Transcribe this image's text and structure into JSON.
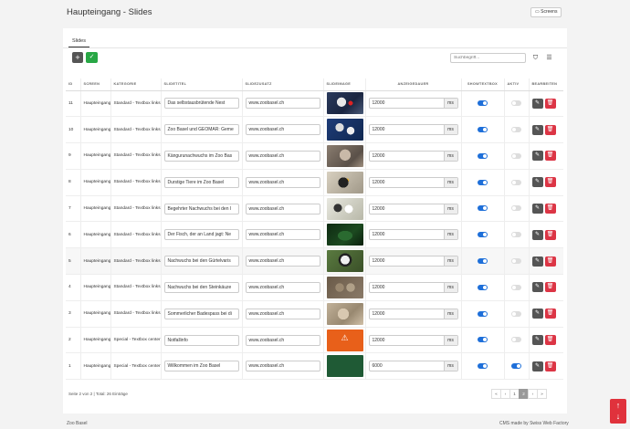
{
  "header": {
    "title": "Haupteingang - Slides",
    "screens_label": "Screens"
  },
  "tabs": [
    {
      "label": "Slides"
    }
  ],
  "toolbar": {
    "add_label": "+",
    "check_label": "✓",
    "search_placeholder": "Suchbegriff..."
  },
  "columns": [
    "ID",
    "SCREEN",
    "KATEGORIE",
    "SLIDETITEL",
    "SLIDEZUSATZ",
    "SLIDEIMAGE",
    "ANZEIGEDAUER",
    "SHOWTEXTBOX",
    "AKTIV",
    "BEARBEITEN"
  ],
  "rows": [
    {
      "id": "11",
      "screen": "Haupteingang",
      "kategorie": "Standard - Textbox links",
      "titel": "Das selbstausbrütende Nest",
      "zusatz": "www.zoobasel.ch",
      "image": "penguins",
      "dauer": "12000",
      "unit": "ms",
      "showtextbox": true,
      "aktiv": false
    },
    {
      "id": "10",
      "screen": "Haupteingang",
      "kategorie": "Standard - Textbox links",
      "titel": "Zoo Basel und GEOMAR: Geme",
      "zusatz": "www.zoobasel.ch",
      "image": "penguins-2",
      "dauer": "12000",
      "unit": "ms",
      "showtextbox": true,
      "aktiv": false
    },
    {
      "id": "9",
      "screen": "Haupteingang",
      "kategorie": "Standard - Textbox links",
      "titel": "Kängurunachwuchs im Zoo Bas",
      "zusatz": "www.zoobasel.ch",
      "image": "kangaroo",
      "dauer": "12000",
      "unit": "ms",
      "showtextbox": true,
      "aktiv": false
    },
    {
      "id": "8",
      "screen": "Haupteingang",
      "kategorie": "Standard - Textbox links",
      "titel": "Durstige Tiere im Zoo Basel",
      "zusatz": "www.zoobasel.ch",
      "image": "bird",
      "dauer": "12000",
      "unit": "ms",
      "showtextbox": true,
      "aktiv": false
    },
    {
      "id": "7",
      "screen": "Haupteingang",
      "kategorie": "Standard - Textbox links",
      "titel": "Begehrter Nachwuchs bei den I",
      "zusatz": "www.zoobasel.ch",
      "image": "penguins-3",
      "dauer": "12000",
      "unit": "ms",
      "showtextbox": true,
      "aktiv": false
    },
    {
      "id": "6",
      "screen": "Haupteingang",
      "kategorie": "Standard - Textbox links",
      "titel": "Der Fisch, der an Land jagt: Ne",
      "zusatz": "www.zoobasel.ch",
      "image": "fish",
      "dauer": "12000",
      "unit": "ms",
      "showtextbox": true,
      "aktiv": false
    },
    {
      "id": "5",
      "screen": "Haupteingang",
      "kategorie": "Standard - Textbox links",
      "titel": "Nachwuchs bei den Gürtelvaris",
      "zusatz": "www.zoobasel.ch",
      "image": "lemur",
      "dauer": "12000",
      "unit": "ms",
      "showtextbox": true,
      "aktiv": false
    },
    {
      "id": "4",
      "screen": "Haupteingang",
      "kategorie": "Standard - Textbox links",
      "titel": "Nachwuchs bei den Steinkäuze",
      "zusatz": "www.zoobasel.ch",
      "image": "owls",
      "dauer": "12000",
      "unit": "ms",
      "showtextbox": true,
      "aktiv": false
    },
    {
      "id": "3",
      "screen": "Haupteingang",
      "kategorie": "Standard - Textbox links",
      "titel": "Sommerlicher Badespass bei di",
      "zusatz": "www.zoobasel.ch",
      "image": "animals",
      "dauer": "12000",
      "unit": "ms",
      "showtextbox": true,
      "aktiv": false
    },
    {
      "id": "2",
      "screen": "Haupteingang",
      "kategorie": "Special - Textbox center",
      "titel": "Notfallinfo",
      "zusatz": "www.zoobasel.ch",
      "image": "warning",
      "dauer": "12000",
      "unit": "ms",
      "showtextbox": true,
      "aktiv": false
    },
    {
      "id": "1",
      "screen": "Haupteingang",
      "kategorie": "Special - Textbox center",
      "titel": "Willkommen im Zoo Basel",
      "zusatz": "www.zoobasel.ch",
      "image": "green",
      "dauer": "6000",
      "unit": "ms",
      "showtextbox": true,
      "aktiv": true
    }
  ],
  "pagination": {
    "info": "Seite 2 von 2 | Total: 26 Einträge",
    "pages": [
      "«",
      "‹",
      "1",
      "2",
      "›",
      "»"
    ],
    "active": "2"
  },
  "footer": {
    "left": "Zoo Basel",
    "right": "CMS made by Swiss Web Factory"
  },
  "colors": {
    "accent": "#1e6fd9",
    "success": "#28a745",
    "danger": "#dc3545"
  }
}
